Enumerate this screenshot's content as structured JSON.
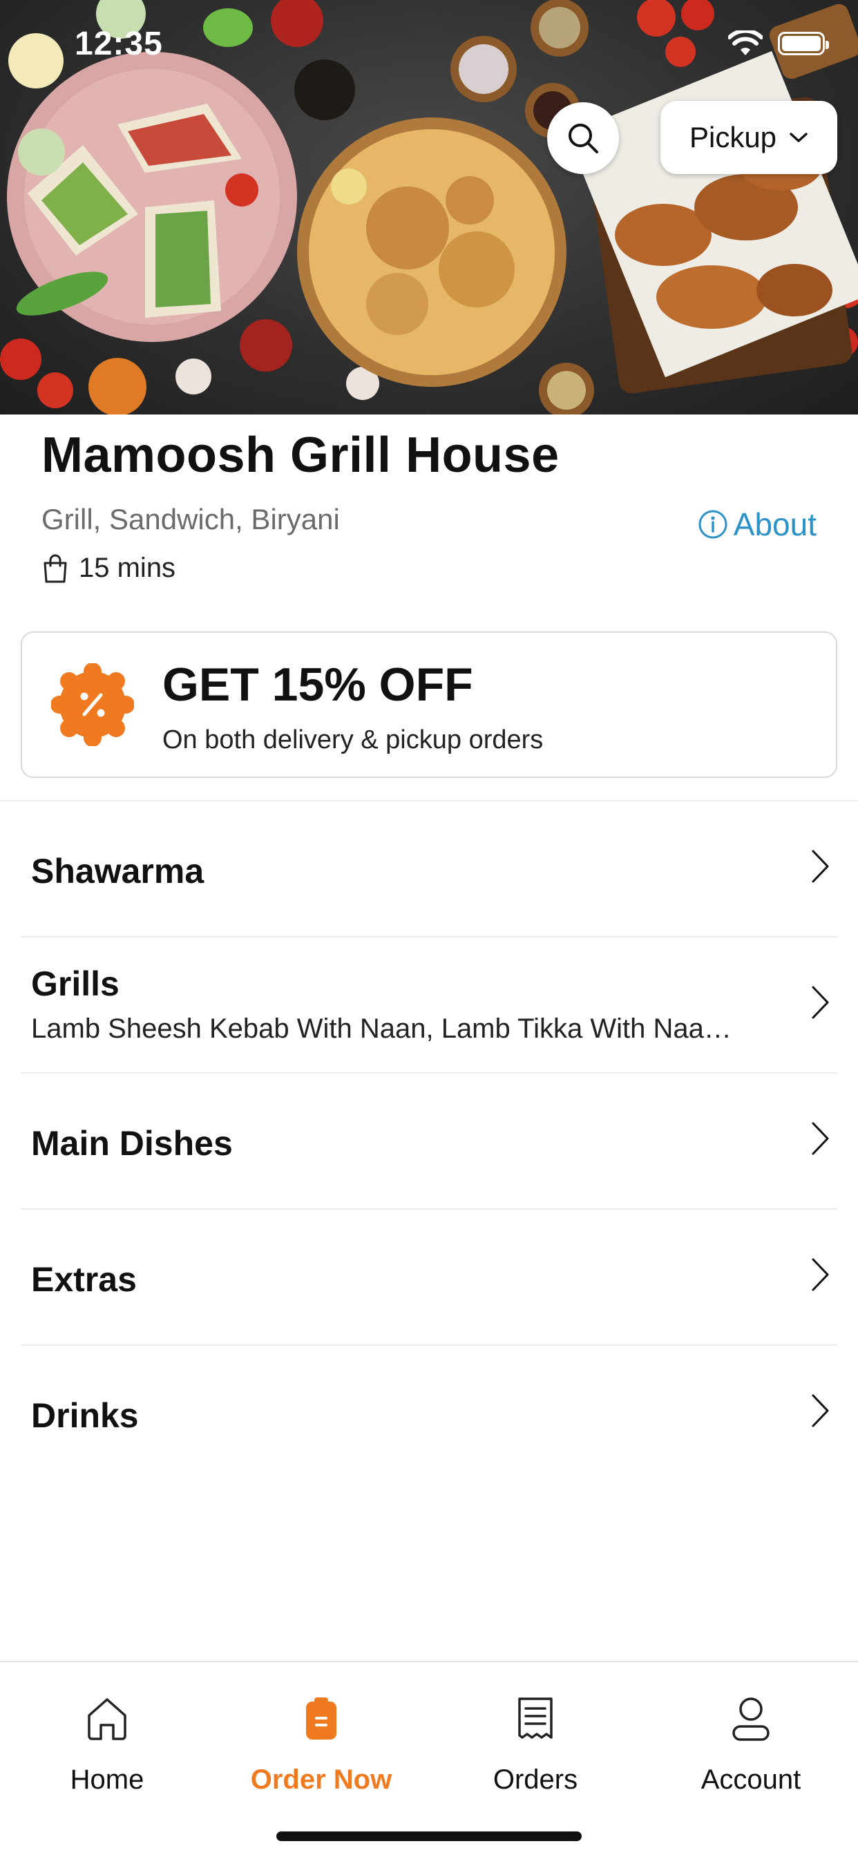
{
  "status_bar": {
    "time": "12:35"
  },
  "header": {
    "search_icon": "search-icon",
    "order_mode": "Pickup",
    "order_mode_icon": "chevron-down-icon"
  },
  "restaurant": {
    "name": "Mamoosh Grill House",
    "cuisines": "Grill, Sandwich, Biryani",
    "about_label": "About",
    "eta_label": "15 mins",
    "eta_icon": "shopping-bag-icon"
  },
  "promo": {
    "title": "GET 15% OFF",
    "subtitle": "On both delivery & pickup orders",
    "badge_icon": "discount-badge-icon",
    "badge_color": "#ef7a1f"
  },
  "menu": {
    "categories": [
      {
        "title": "Shawarma",
        "description": ""
      },
      {
        "title": "Grills",
        "description": "Lamb Sheesh Kebab With Naan, Lamb Tikka With Naa…"
      },
      {
        "title": "Main Dishes",
        "description": ""
      },
      {
        "title": "Extras",
        "description": ""
      },
      {
        "title": "Drinks",
        "description": ""
      }
    ]
  },
  "bottom_nav": {
    "items": [
      {
        "label": "Home",
        "icon": "home-icon",
        "active": false
      },
      {
        "label": "Order Now",
        "icon": "order-bag-icon",
        "active": true
      },
      {
        "label": "Orders",
        "icon": "receipt-icon",
        "active": false
      },
      {
        "label": "Account",
        "icon": "person-icon",
        "active": false
      }
    ]
  },
  "colors": {
    "accent": "#ef7a1f",
    "link": "#2b93c7",
    "text": "#111111",
    "muted": "#6b6b6b"
  }
}
